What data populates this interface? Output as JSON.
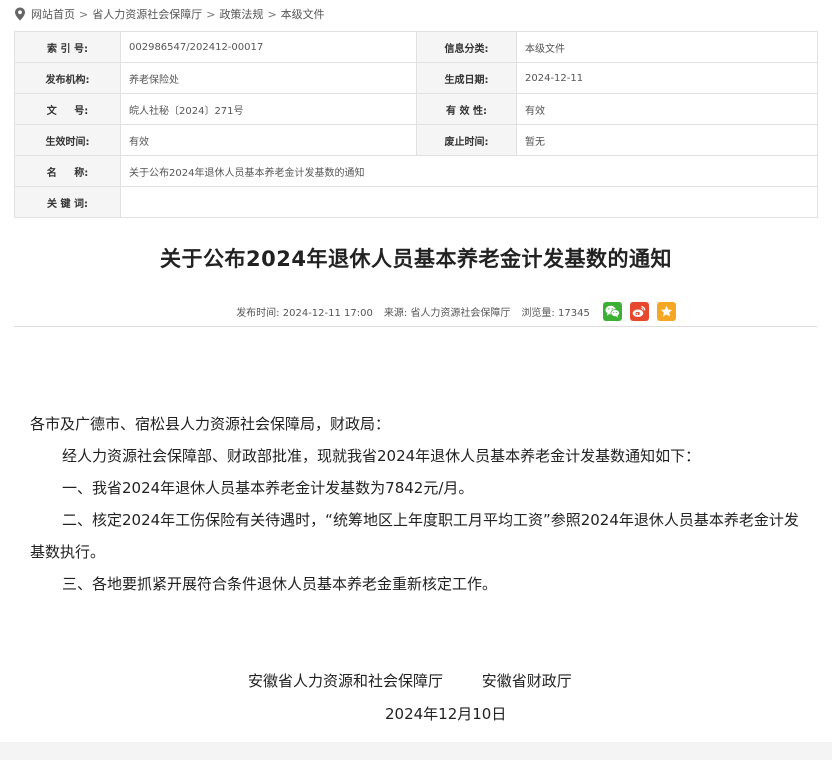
{
  "breadcrumb": {
    "items": [
      "网站首页",
      "省人力资源社会保障厅",
      "政策法规",
      "本级文件"
    ],
    "separator": ">"
  },
  "meta": {
    "index_label": "索 引 号:",
    "index_value": "002986547/202412-00017",
    "category_label": "信息分类:",
    "category_value": "本级文件",
    "publisher_label": "发布机构:",
    "publisher_value": "养老保险处",
    "created_label": "生成日期:",
    "created_value": "2024-12-11",
    "docno_label": "文     号:",
    "docno_value": "皖人社秘〔2024〕271号",
    "validity_label": "有 效 性:",
    "validity_value": "有效",
    "effective_label": "生效时间:",
    "effective_value": "有效",
    "repeal_label": "废止时间:",
    "repeal_value": "暂无",
    "name_label": "名     称:",
    "name_value": "关于公布2024年退休人员基本养老金计发基数的通知",
    "keywords_label": "关 键 词:",
    "keywords_value": ""
  },
  "article": {
    "title": "关于公布2024年退休人员基本养老金计发基数的通知",
    "publish_time_label": "发布时间:",
    "publish_time": "2024-12-11 17:00",
    "source_label": "来源:",
    "source": "省人力资源社会保障厅",
    "views_label": "浏览量:",
    "views": "17345",
    "paragraphs": {
      "salutation": "各市及广德市、宿松县人力资源社会保障局，财政局：",
      "p1": "经人力资源社会保障部、财政部批准，现就我省2024年退休人员基本养老金计发基数通知如下：",
      "p2": "一、我省2024年退休人员基本养老金计发基数为7842元/月。",
      "p3": "二、核定2024年工伤保险有关待遇时，“统筹地区上年度职工月平均工资”参照2024年退休人员基本养老金计发基数执行。",
      "p4": "三、各地要抓紧开展符合条件退休人员基本养老金重新核定工作。"
    },
    "signatory_1": "安徽省人力资源和社会保障厅",
    "signatory_2": "安徽省财政厅",
    "date": "2024年12月10日"
  },
  "share": {
    "wechat_icon": "wechat-icon",
    "weibo_icon": "weibo-icon",
    "favorite_icon": "star-icon",
    "colors": {
      "wechat": "#3cb035",
      "weibo": "#e6472d",
      "favorite": "#f5a623"
    }
  }
}
